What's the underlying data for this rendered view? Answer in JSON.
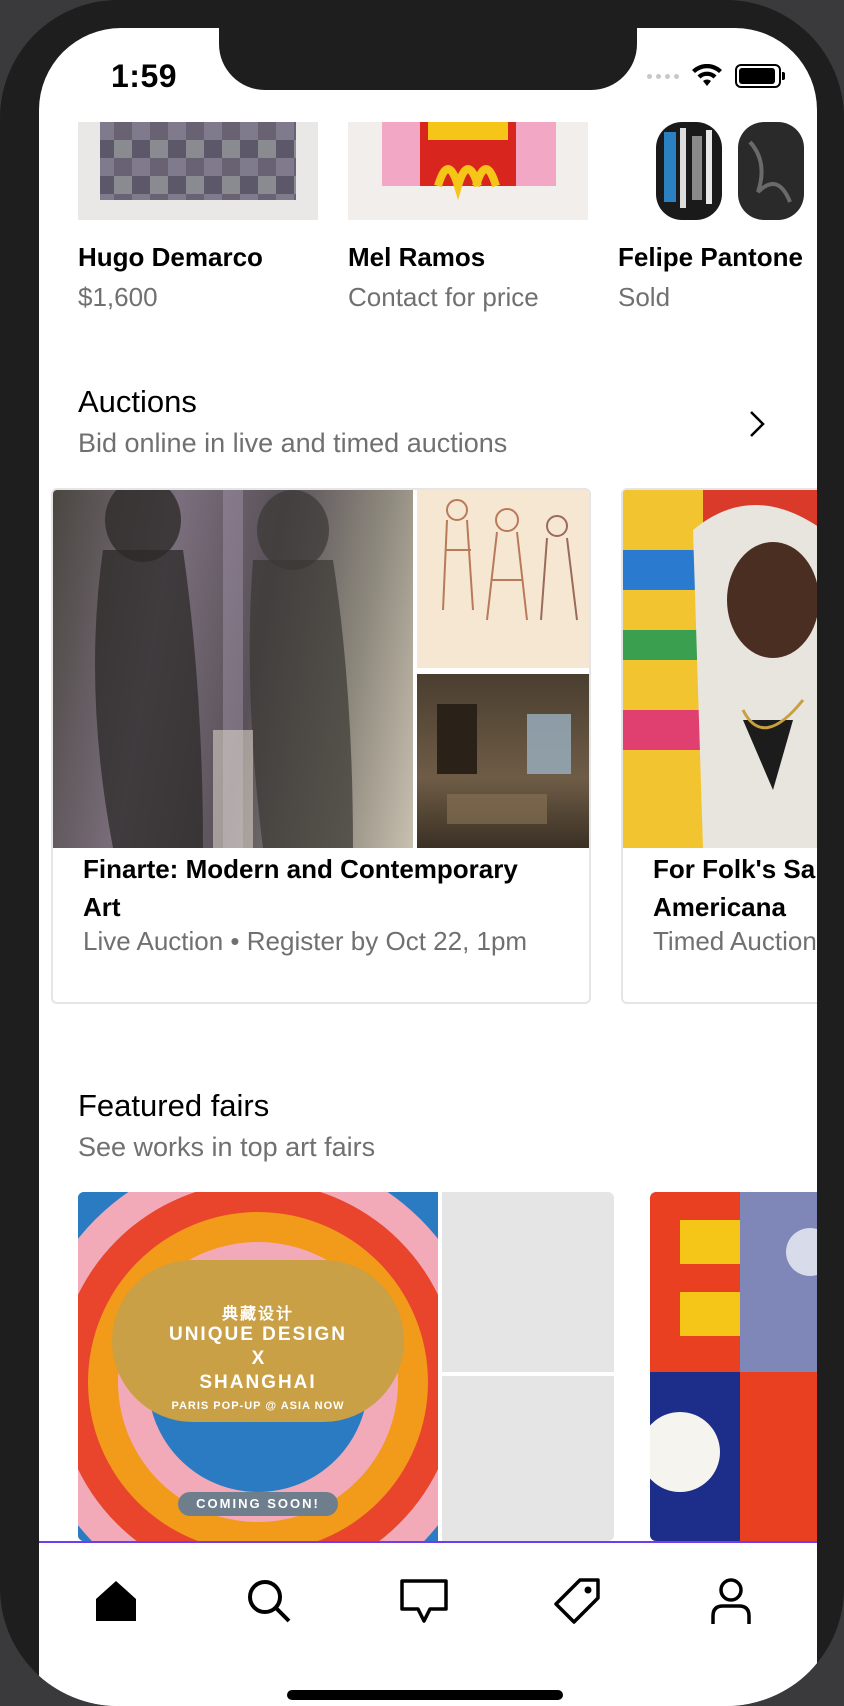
{
  "status_bar": {
    "time": "1:59",
    "battery_level": 0.95
  },
  "artworks": [
    {
      "artist": "Hugo Demarco",
      "price": "$1,600"
    },
    {
      "artist": "Mel Ramos",
      "price": "Contact for price"
    },
    {
      "artist": "Felipe Pantone",
      "price": "Sold"
    }
  ],
  "auctions": {
    "title": "Auctions",
    "subtitle": "Bid online in live and timed auctions",
    "cards": [
      {
        "title": "Finarte: Modern and Contemporary Art",
        "subtitle": "Live Auction • Register by Oct 22, 1pm"
      },
      {
        "title": "For Folk's Sake: Self-Taught Artists + Americana",
        "subtitle": "Timed Auction"
      }
    ]
  },
  "featured_fairs": {
    "title": "Featured fairs",
    "subtitle": "See works in top art fairs",
    "poster": {
      "line1": "典藏设计",
      "line2": "UNIQUE DESIGN",
      "line3": "X",
      "line4": "SHANGHAI",
      "line5": "PARIS POP-UP @ ASIA NOW",
      "badge": "COMING SOON!"
    }
  },
  "tab_bar": {
    "tabs": [
      {
        "icon": "home-icon",
        "active": true
      },
      {
        "icon": "search-icon",
        "active": false
      },
      {
        "icon": "inbox-icon",
        "active": false
      },
      {
        "icon": "sell-tag-icon",
        "active": false
      },
      {
        "icon": "profile-icon",
        "active": false
      }
    ],
    "accent": "#6e3df0"
  }
}
